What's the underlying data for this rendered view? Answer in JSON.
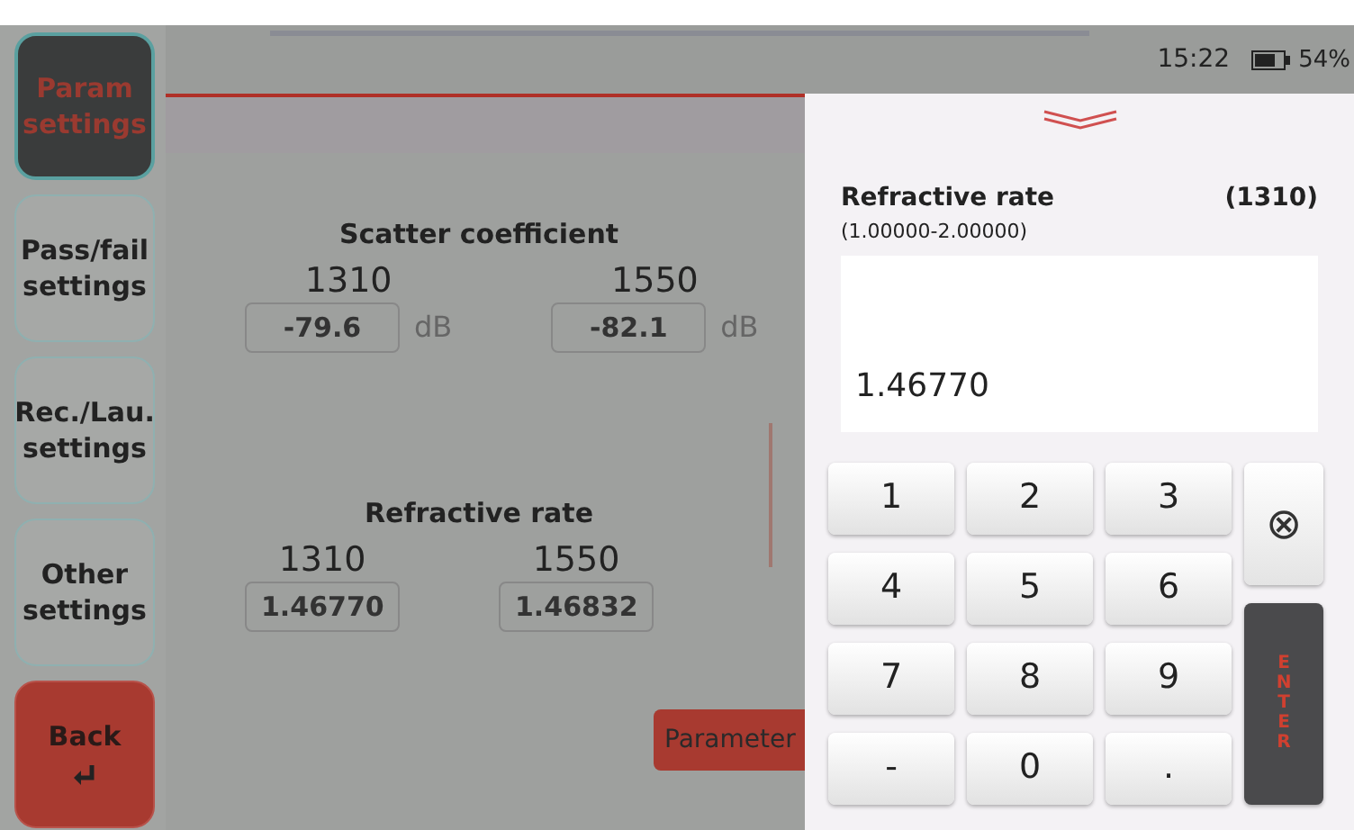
{
  "sidebar": {
    "items": [
      {
        "label": "Param settings",
        "kind": "nav",
        "selected": true
      },
      {
        "label": "Pass/fail settings",
        "kind": "nav",
        "selected": false
      },
      {
        "label": "Rec./Lau. settings",
        "kind": "nav",
        "selected": false
      },
      {
        "label": "Other settings",
        "kind": "nav",
        "selected": false
      }
    ]
  },
  "back_button": "Back",
  "status_bar": {
    "time": "15:22",
    "battery": "54%"
  },
  "scatter": {
    "title": "Scatter coefficient",
    "fields": [
      {
        "label": "1310",
        "value": "-79.6",
        "unit": "dB"
      },
      {
        "label": "1550",
        "value": "-82.1",
        "unit": "dB"
      }
    ]
  },
  "refractive": {
    "title": "Refractive rate",
    "fields": [
      {
        "label": "1310",
        "value": "1.46770"
      },
      {
        "label": "1550",
        "value": "1.46832"
      }
    ]
  },
  "parameter_button": "Parameter",
  "keypad_panel": {
    "title": "Refractive rate",
    "wavelength": "(1310)",
    "range": "(1.00000-2.00000)",
    "value": "1.46770",
    "keys": [
      {
        "label": "1",
        "kind": "digit"
      },
      {
        "label": "2",
        "kind": "digit"
      },
      {
        "label": "3",
        "kind": "digit"
      },
      {
        "label": "⊗",
        "kind": "clear"
      },
      {
        "label": "4",
        "kind": "digit"
      },
      {
        "label": "5",
        "kind": "digit"
      },
      {
        "label": "6",
        "kind": "digit"
      },
      {
        "label": "7",
        "kind": "digit"
      },
      {
        "label": "8",
        "kind": "digit"
      },
      {
        "label": "9",
        "kind": "digit"
      },
      {
        "label": "-",
        "kind": "digit"
      },
      {
        "label": "0",
        "kind": "digit"
      },
      {
        "label": ".",
        "kind": "digit"
      },
      {
        "label": "ENTER",
        "kind": "enter"
      }
    ]
  }
}
